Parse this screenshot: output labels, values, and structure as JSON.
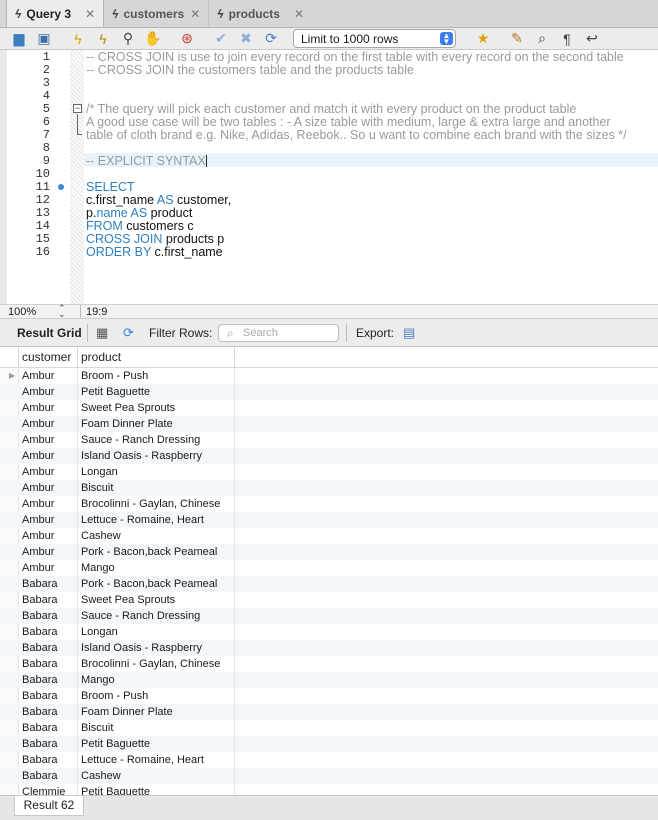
{
  "tabs": [
    {
      "label": "Query 3",
      "active": true
    },
    {
      "label": "customers",
      "active": false
    },
    {
      "label": "products",
      "active": false
    }
  ],
  "toolbar": {
    "limit_value": "Limit to 1000 rows"
  },
  "editor": {
    "lines": [
      {
        "n": "1",
        "text": "-- CROSS JOIN is use to join every record on the first table with every record on the second table"
      },
      {
        "n": "2",
        "text": "-- CROSS JOIN the customers table and the products table"
      },
      {
        "n": "3",
        "text": ""
      },
      {
        "n": "4",
        "text": ""
      },
      {
        "n": "5",
        "text": "/* The query will pick each customer and match it with every product on the product table"
      },
      {
        "n": "6",
        "text": "A good use case will be two tables : - A size table with medium, large & extra large and another"
      },
      {
        "n": "7",
        "text": "table of cloth brand e.g. Nike, Adidas, Reebok.. So u want to combine each brand with the sizes */"
      },
      {
        "n": "8",
        "text": ""
      },
      {
        "n": "9",
        "text": "-- EXPLICIT SYNTAX"
      },
      {
        "n": "10",
        "text": ""
      },
      {
        "n": "11",
        "text": ""
      },
      {
        "n": "12",
        "text": ""
      },
      {
        "n": "13",
        "text": ""
      },
      {
        "n": "14",
        "text": ""
      },
      {
        "n": "15",
        "text": ""
      },
      {
        "n": "16",
        "text": ""
      }
    ],
    "sql": {
      "select": "SELECT",
      "l12_a": "c.first_name ",
      "l12_kw": "AS",
      "l12_b": " customer,",
      "l13_a": "p.",
      "l13_kw1": "name",
      "l13_kw2": " AS",
      "l13_b": " product",
      "l14_kw": "FROM",
      "l14_b": " customers c",
      "l15_kw": "CROSS JOIN",
      "l15_b": " products p",
      "l16_kw": "ORDER BY",
      "l16_b": " c.first_name"
    }
  },
  "status": {
    "zoom": "100%",
    "position": "19:9"
  },
  "result_toolbar": {
    "title": "Result Grid",
    "filter_label": "Filter Rows:",
    "search_placeholder": "Search",
    "export_label": "Export:"
  },
  "grid": {
    "columns": [
      "customer",
      "product"
    ],
    "rows": [
      [
        "Ambur",
        "Broom - Push"
      ],
      [
        "Ambur",
        "Petit Baguette"
      ],
      [
        "Ambur",
        "Sweet Pea Sprouts"
      ],
      [
        "Ambur",
        "Foam Dinner Plate"
      ],
      [
        "Ambur",
        "Sauce - Ranch Dressing"
      ],
      [
        "Ambur",
        "Island Oasis - Raspberry"
      ],
      [
        "Ambur",
        "Longan"
      ],
      [
        "Ambur",
        "Biscuit"
      ],
      [
        "Ambur",
        "Brocolinni - Gaylan, Chinese"
      ],
      [
        "Ambur",
        "Lettuce - Romaine, Heart"
      ],
      [
        "Ambur",
        "Cashew"
      ],
      [
        "Ambur",
        "Pork - Bacon,back Peameal"
      ],
      [
        "Ambur",
        "Mango"
      ],
      [
        "Babara",
        "Pork - Bacon,back Peameal"
      ],
      [
        "Babara",
        "Sweet Pea Sprouts"
      ],
      [
        "Babara",
        "Sauce - Ranch Dressing"
      ],
      [
        "Babara",
        "Longan"
      ],
      [
        "Babara",
        "Island Oasis - Raspberry"
      ],
      [
        "Babara",
        "Brocolinni - Gaylan, Chinese"
      ],
      [
        "Babara",
        "Mango"
      ],
      [
        "Babara",
        "Broom - Push"
      ],
      [
        "Babara",
        "Foam Dinner Plate"
      ],
      [
        "Babara",
        "Biscuit"
      ],
      [
        "Babara",
        "Petit Baguette"
      ],
      [
        "Babara",
        "Lettuce - Romaine, Heart"
      ],
      [
        "Babara",
        "Cashew"
      ],
      [
        "Clemmie",
        "Petit Baguette"
      ]
    ]
  },
  "bottom": {
    "result_tab": "Result 62"
  }
}
